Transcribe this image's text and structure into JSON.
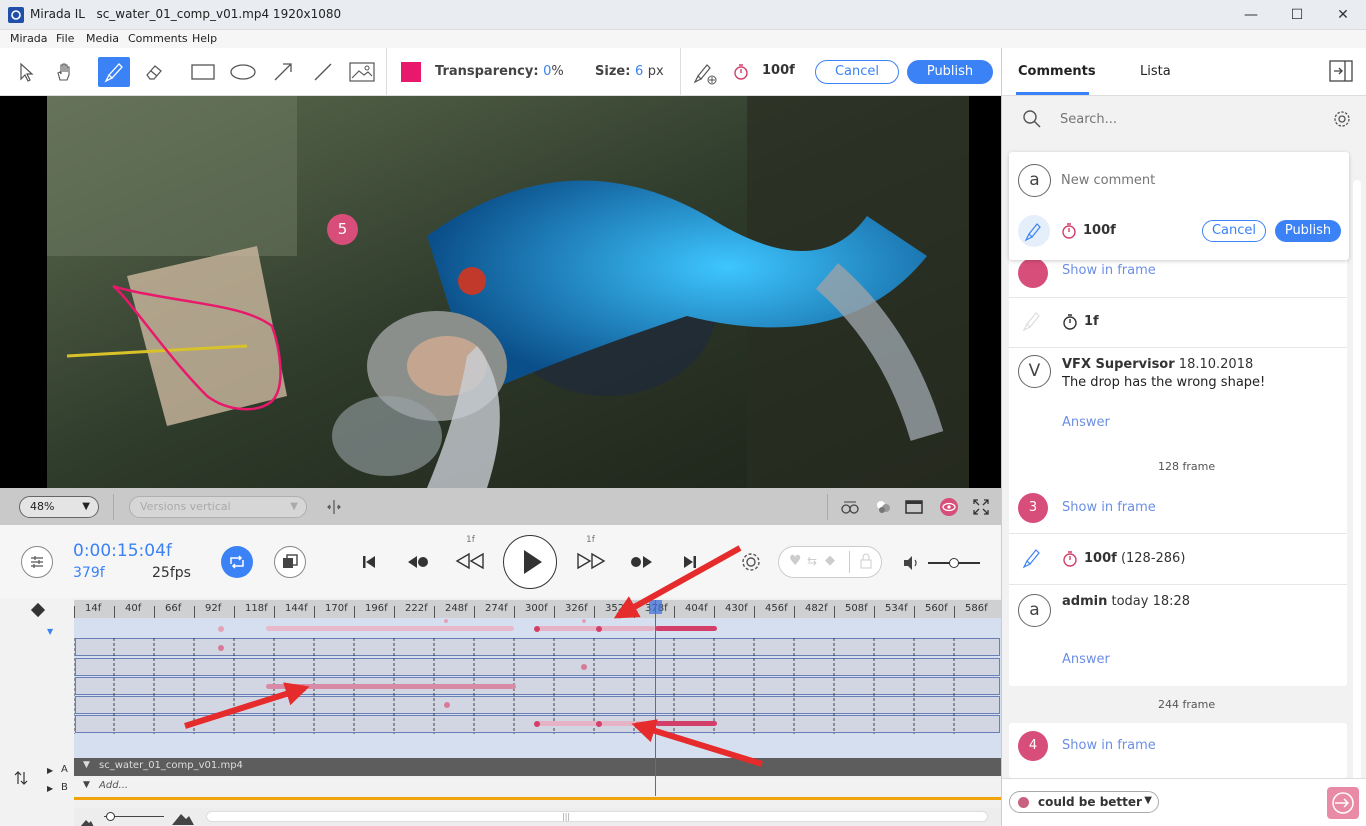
{
  "window": {
    "app_name": "Mirada IL",
    "file_title": "sc_water_01_comp_v01.mp4 1920x1080",
    "minimize": "—",
    "maximize": "☐",
    "close": "✕"
  },
  "menu": [
    "Mirada",
    "File",
    "Media",
    "Comments",
    "Help"
  ],
  "toolbar": {
    "tools": [
      "pointer-icon",
      "hand-icon",
      "brush-icon",
      "eraser-icon",
      "rectangle-icon",
      "ellipse-icon",
      "arrow-icon",
      "line-icon",
      "image-icon"
    ],
    "color": "#e8196d",
    "transparency_label": "Transparency:",
    "transparency_value": "0",
    "transparency_unit": "%",
    "size_label": "Size:",
    "size_value": "6",
    "size_unit": "px",
    "frame": "100f",
    "cancel": "Cancel",
    "publish": "Publish"
  },
  "viewer": {
    "marker_number": "5"
  },
  "viewbar": {
    "zoom": "48%",
    "versions": "Versions vertical"
  },
  "transport": {
    "timecode": "0:00:15:04f",
    "frame": "379f",
    "fps": "25fps",
    "step_back_label": "1f",
    "step_forward_label": "1f"
  },
  "ruler": [
    "14f",
    "40f",
    "66f",
    "92f",
    "118f",
    "144f",
    "170f",
    "196f",
    "222f",
    "248f",
    "274f",
    "300f",
    "326f",
    "352f",
    "378f",
    "404f",
    "430f",
    "456f",
    "482f",
    "508f",
    "534f",
    "560f",
    "586f"
  ],
  "tracks": {
    "row_a_label": "A",
    "row_b_label": "B",
    "clip_name": "sc_water_01_comp_v01.mp4",
    "add_label": "Add..."
  },
  "panel": {
    "tabs": [
      "Comments",
      "Lista"
    ],
    "search_placeholder": "Search...",
    "new_comment": {
      "avatar": "a",
      "placeholder": "New comment",
      "frame": "100f",
      "cancel": "Cancel",
      "publish": "Publish"
    },
    "partial_show_in_frame": "Show in frame",
    "partial_frame": "1f",
    "partial_comment": {
      "avatar": "V",
      "author": "VFX Supervisor",
      "date": "18.10.2018",
      "text": "The drop has the wrong shape!",
      "answer": "Answer"
    },
    "group1": {
      "header": "128 frame",
      "number": "3",
      "show_in_frame": "Show in frame",
      "frame": "100f",
      "range": "(128-286)",
      "comment": {
        "avatar": "a",
        "author": "admin",
        "date": "today 18:28",
        "answer": "Answer"
      }
    },
    "group2": {
      "header": "244 frame",
      "number": "4",
      "show_in_frame": "Show in frame"
    },
    "status": "could be better"
  }
}
